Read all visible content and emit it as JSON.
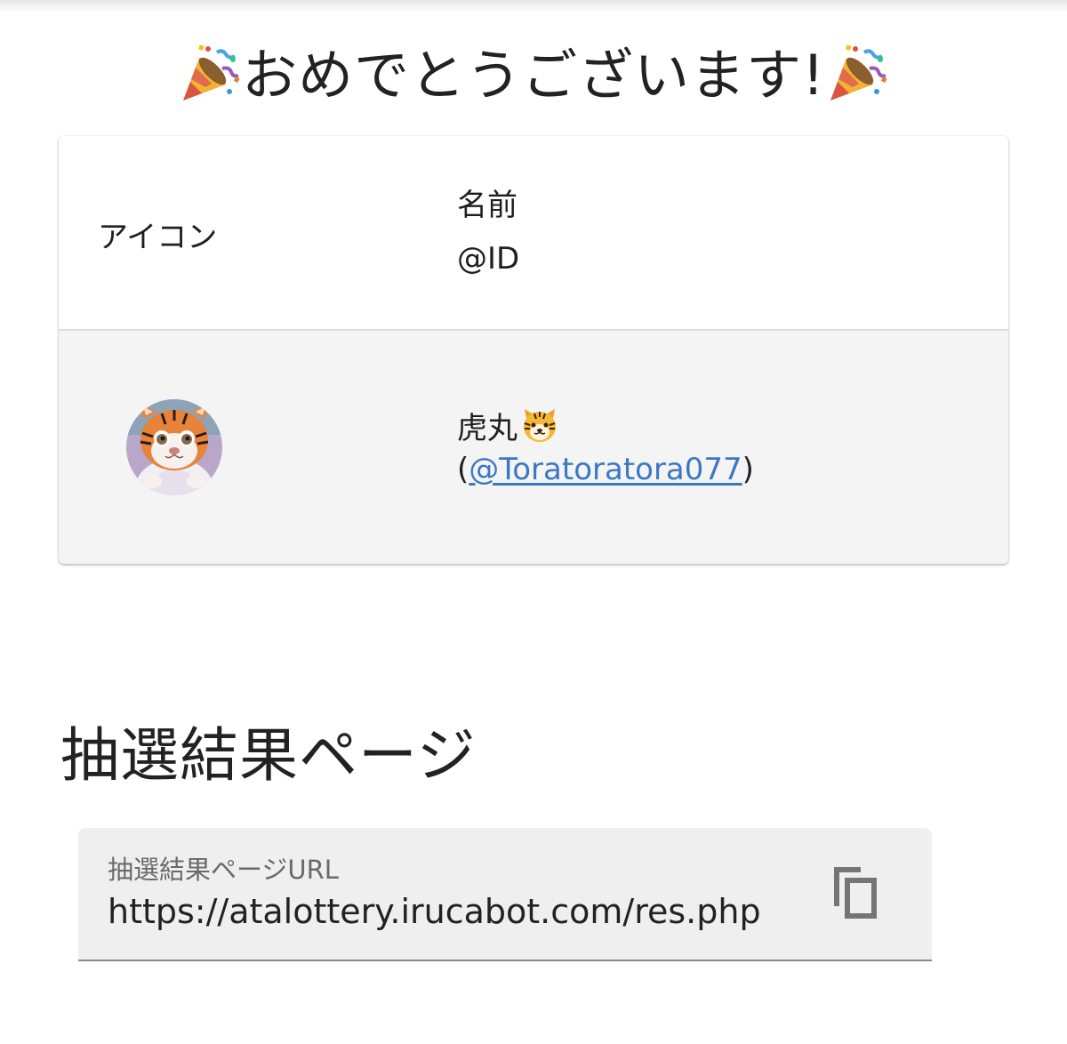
{
  "header": {
    "congrats_text": "おめでとうございます!",
    "icon_left": "party-popper-icon",
    "icon_right": "party-popper-icon"
  },
  "table": {
    "columns": {
      "icon": "アイコン",
      "name": "名前",
      "id": "@ID"
    },
    "rows": [
      {
        "avatar": "tiger-avatar",
        "name": "虎丸",
        "name_emoji": "tiger-face-icon",
        "id_open": "(",
        "id_link": "@Toratoratora077",
        "id_close": ")"
      }
    ]
  },
  "results_section": {
    "title": "抽選結果ページ",
    "url_field": {
      "label": "抽選結果ページURL",
      "value": "https://atalottery.irucabot.com/res.php",
      "copy_icon": "copy-icon"
    }
  },
  "colors": {
    "link": "#3b78c4",
    "row_background": "#f4f4f4",
    "field_background": "#efefef"
  }
}
